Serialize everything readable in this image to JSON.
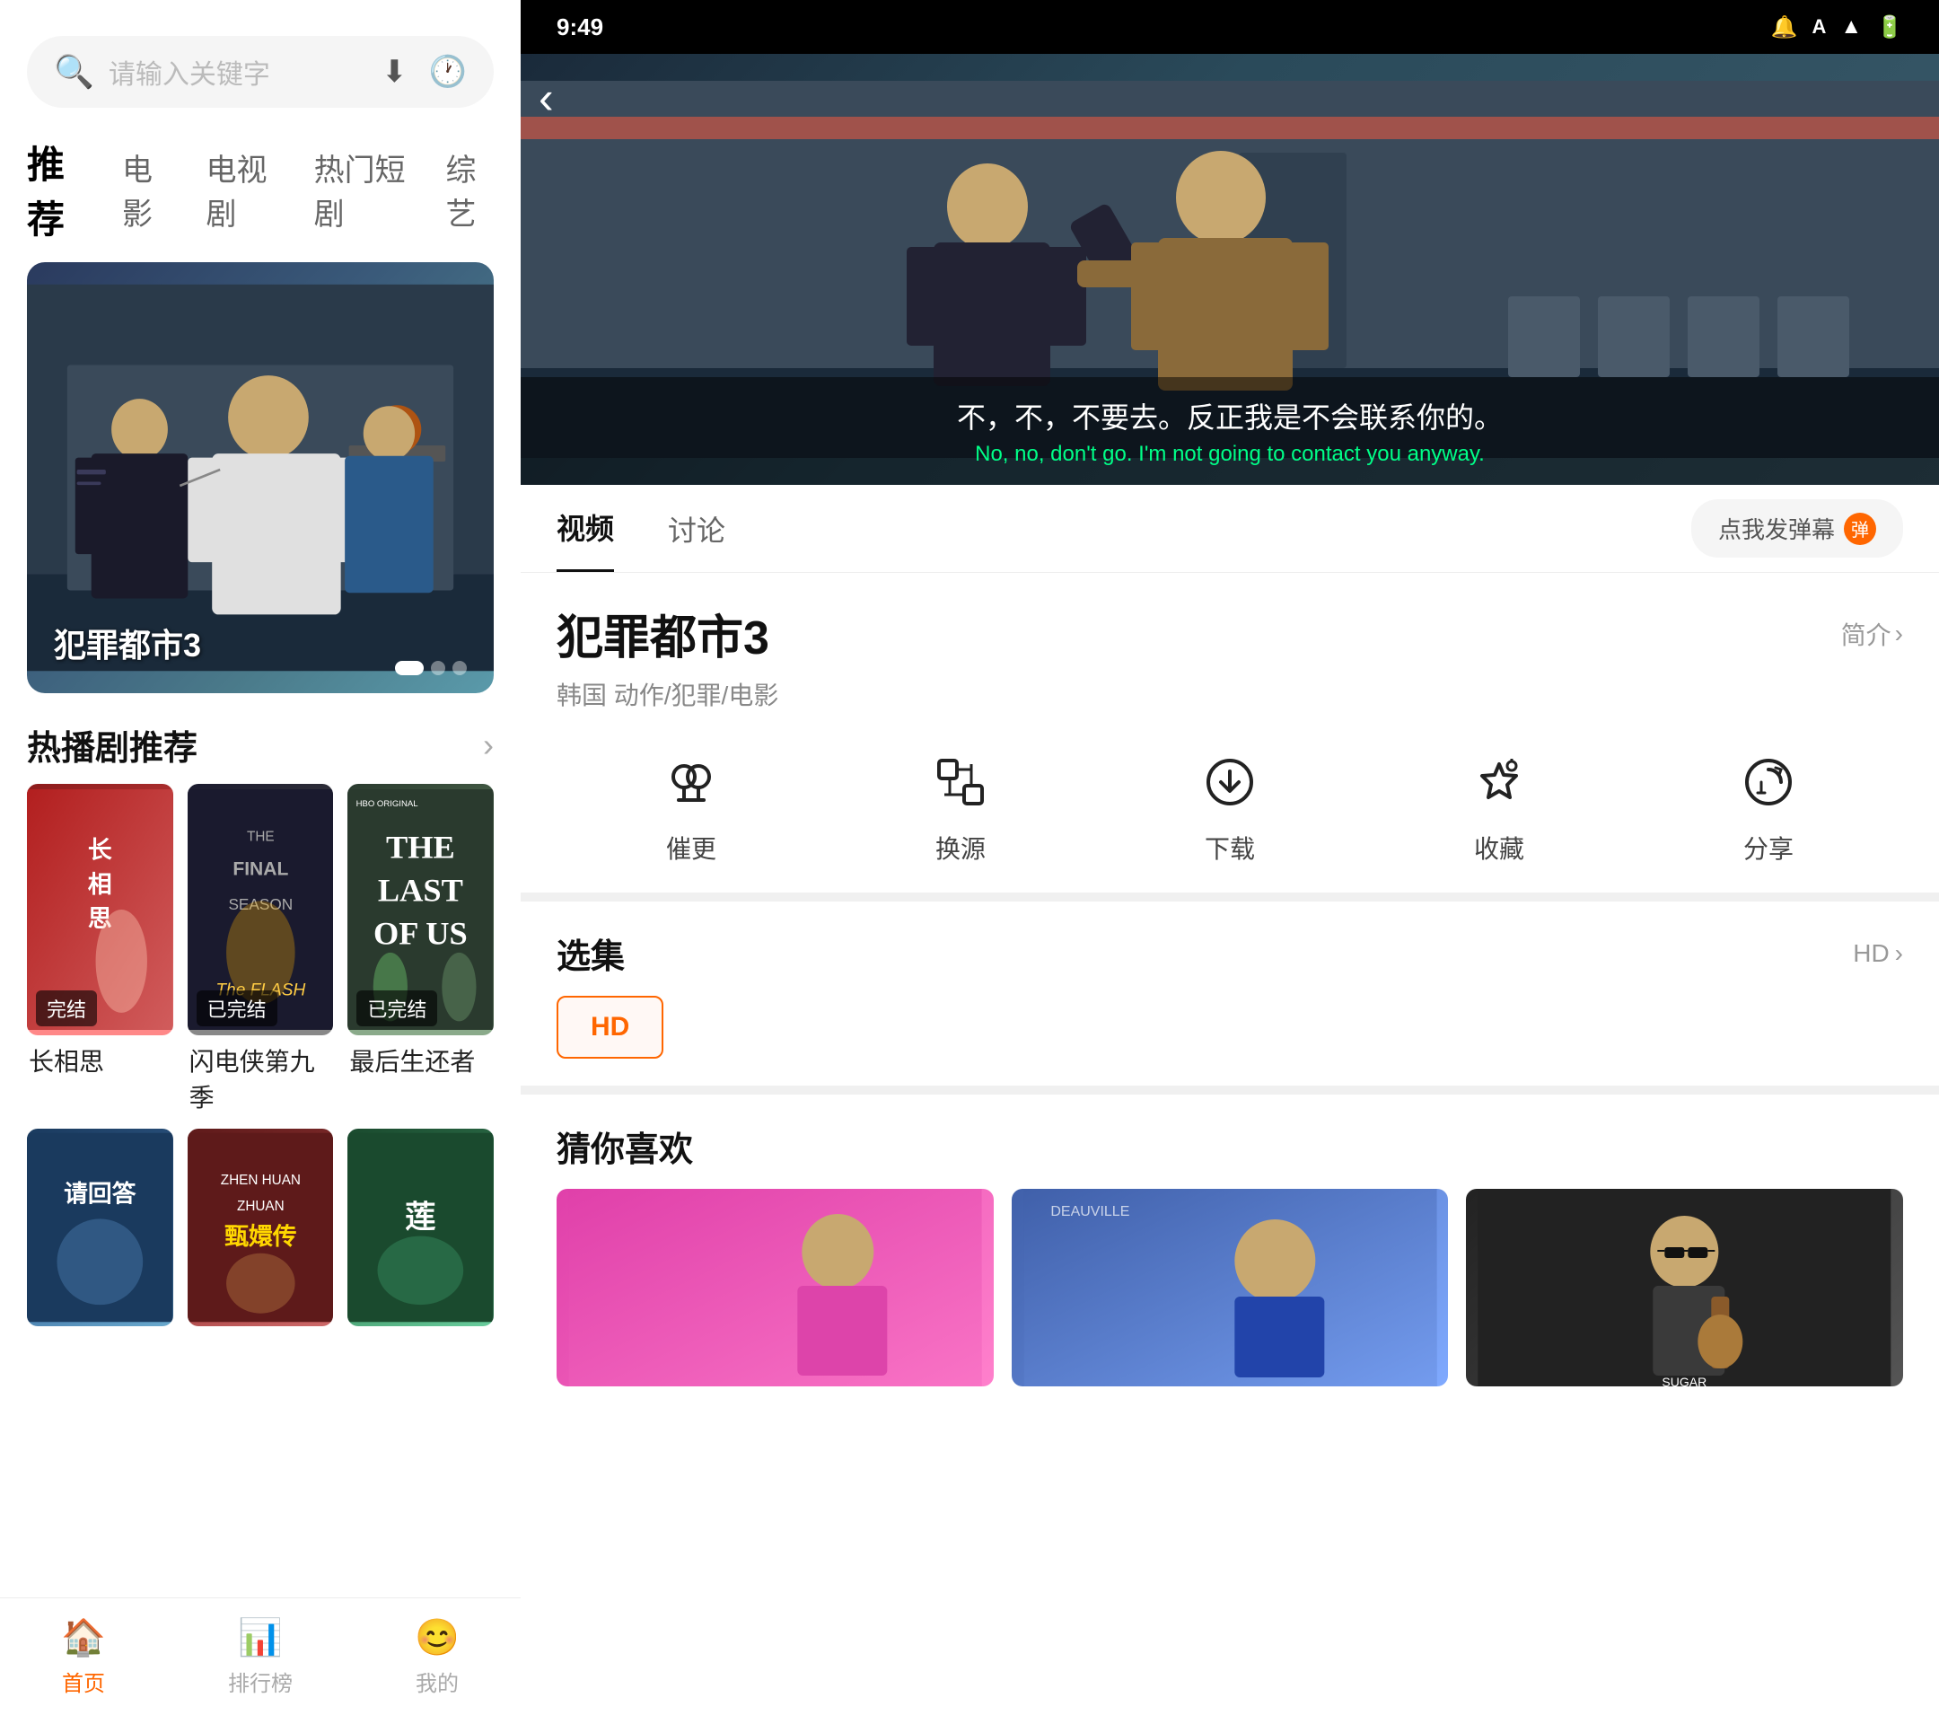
{
  "left": {
    "search": {
      "placeholder": "请输入关键字",
      "download_icon": "⬇",
      "history_icon": "🕐"
    },
    "nav_tabs": [
      {
        "label": "推荐",
        "active": true
      },
      {
        "label": "电影",
        "active": false
      },
      {
        "label": "电视剧",
        "active": false
      },
      {
        "label": "热门短剧",
        "active": false
      },
      {
        "label": "综艺",
        "active": false
      }
    ],
    "hero": {
      "title": "犯罪都市3"
    },
    "hot_section": {
      "title": "热播剧推荐",
      "arrow": "›"
    },
    "dramas": [
      {
        "title": "长相思",
        "badge": "完结",
        "bg": "1"
      },
      {
        "title": "闪电侠第九季",
        "badge": "已完结",
        "bg": "2"
      },
      {
        "title": "最后生还者",
        "badge": "已完结",
        "bg": "3"
      }
    ],
    "dramas2": [
      {
        "title": "请回答",
        "bg": "4"
      },
      {
        "title": "甄嬛传",
        "bg": "5"
      },
      {
        "title": "莲",
        "bg": "6"
      }
    ],
    "bottom_nav": [
      {
        "label": "首页",
        "icon": "🏠",
        "active": true
      },
      {
        "label": "排行榜",
        "icon": "📊",
        "active": false
      },
      {
        "label": "我的",
        "icon": "😊",
        "active": false
      }
    ]
  },
  "right": {
    "status_bar": {
      "time": "9:49",
      "icons": "📶 🔋"
    },
    "video": {
      "back_icon": "‹",
      "subtitle_zh": "不，不，不要去。反正我是不会联系你的。",
      "subtitle_en": "No, no, don't go. I'm not going to contact you anyway."
    },
    "tabs": [
      {
        "label": "视频",
        "active": true
      },
      {
        "label": "讨论",
        "active": false
      }
    ],
    "danmu_btn": "点我发弹幕",
    "danmu_badge": "弹",
    "movie": {
      "title": "犯罪都市3",
      "intro_label": "简介",
      "intro_arrow": "›",
      "tags": "韩国 动作/犯罪/电影"
    },
    "actions": [
      {
        "icon": "🎧",
        "label": "催更"
      },
      {
        "icon": "⇄",
        "label": "换源"
      },
      {
        "icon": "⬇",
        "label": "下载"
      },
      {
        "icon": "☆",
        "label": "收藏"
      },
      {
        "icon": "↻",
        "label": "分享"
      }
    ],
    "episode": {
      "title": "选集",
      "quality_label": "HD",
      "arrow": "›",
      "btn_label": "HD"
    },
    "recommend": {
      "title": "猜你喜欢",
      "cards": [
        {
          "bg": "1"
        },
        {
          "bg": "2"
        },
        {
          "bg": "3"
        }
      ]
    }
  }
}
